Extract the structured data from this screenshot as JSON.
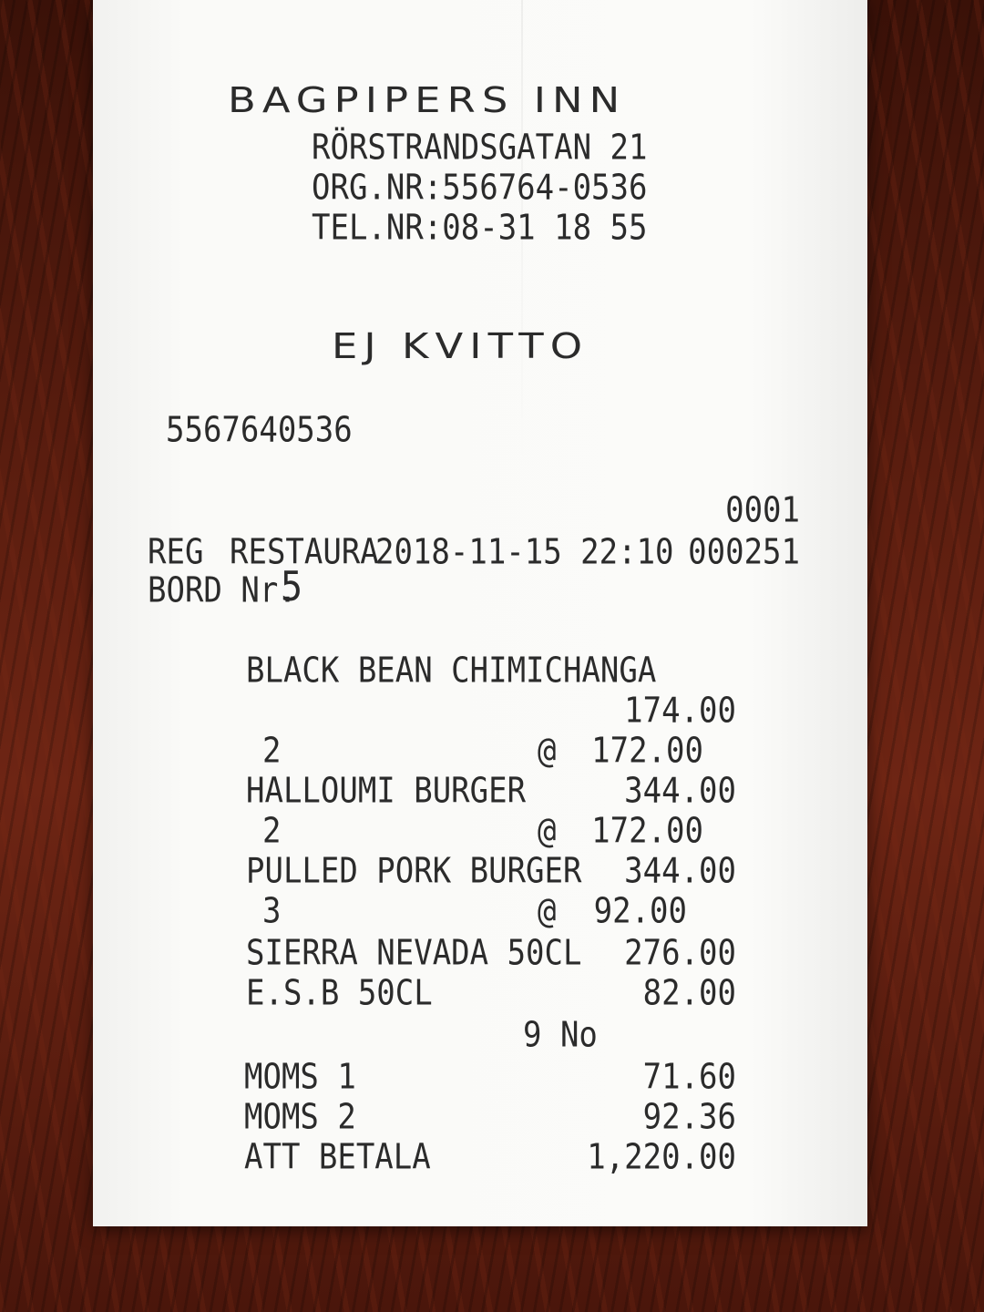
{
  "receipt": {
    "store_name": "BAGPIPERS INN",
    "address": "RÖRSTRANDSGATAN 21",
    "org_nr": "ORG.NR:556764-0536",
    "tel_nr": "TEL.NR:08-31 18 55",
    "doc_type": "EJ KVITTO",
    "org_number": "5567640536",
    "register_no": "0001",
    "reg_label": "REG",
    "reg_name": "RESTAURA",
    "datetime": "2018-11-15 22:10",
    "receipt_no": "000251",
    "table_label": "BORD Nr.",
    "table_no": "5",
    "lines": [
      {
        "name": "BLACK BEAN CHIMICHANGA",
        "amount": "174.00"
      },
      {
        "qty": "2",
        "at": "@",
        "unit_price": "172.00"
      },
      {
        "name": "HALLOUMI BURGER",
        "amount": "344.00"
      },
      {
        "qty": "2",
        "at": "@",
        "unit_price": "172.00"
      },
      {
        "name": "PULLED PORK BURGER",
        "amount": "344.00"
      },
      {
        "qty": "3",
        "at": "@",
        "unit_price": "92.00"
      },
      {
        "name": "SIERRA NEVADA 50CL",
        "amount": "276.00"
      },
      {
        "name": "E.S.B 50CL",
        "amount": "82.00"
      }
    ],
    "item_count": "9 No",
    "moms1_label": "MOMS 1",
    "moms1_value": "71.60",
    "moms2_label": "MOMS 2",
    "moms2_value": "92.36",
    "total_label": "ATT BETALA",
    "total_value": "1,220.00"
  }
}
